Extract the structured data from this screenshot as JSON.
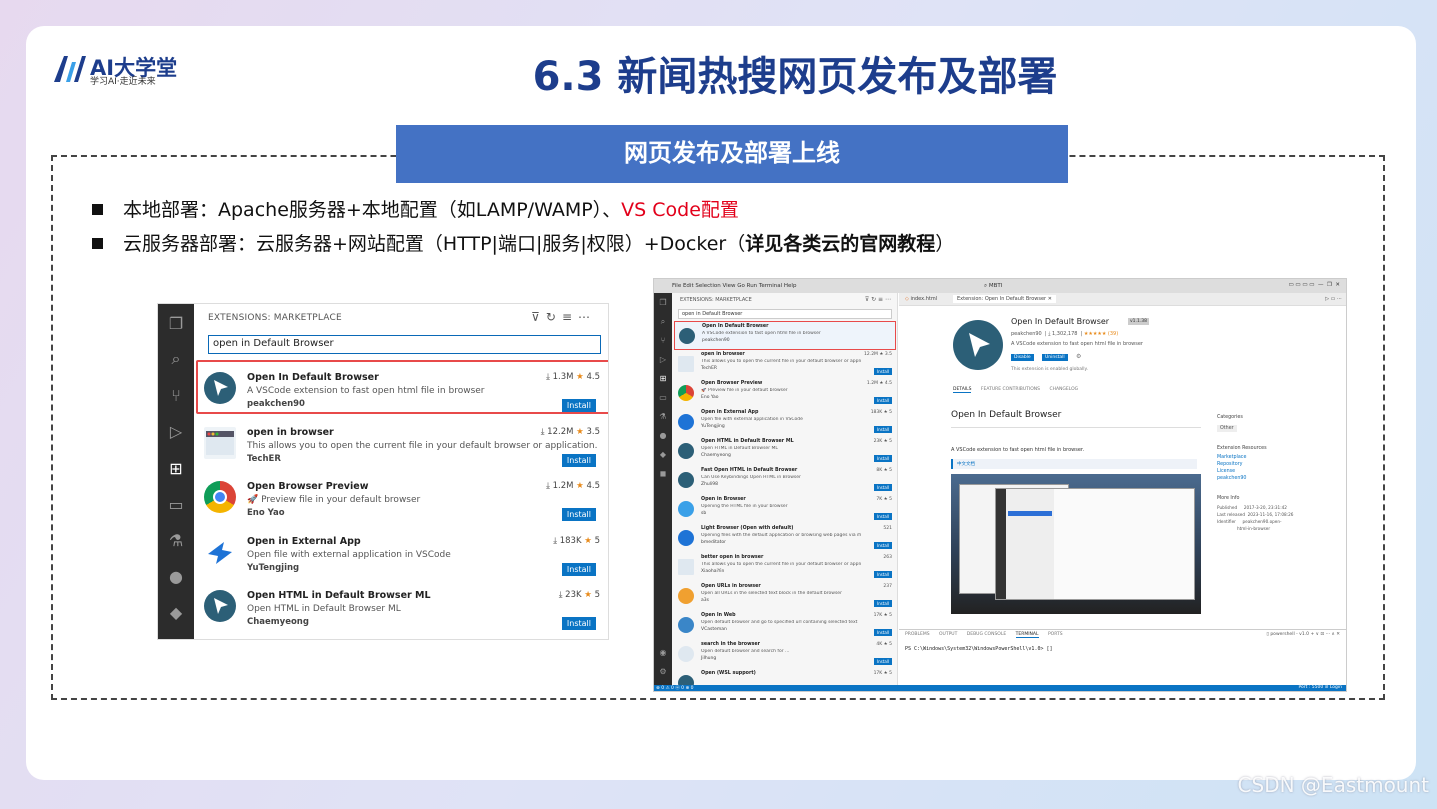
{
  "colors": {
    "accent": "#4472c4",
    "title": "#1d3d8c",
    "red": "#e2001a",
    "install_button": "#0a74c4"
  },
  "logo": {
    "name": "AI大学堂",
    "slogan": "学习AI·走近未来"
  },
  "title": "6.3 新闻热搜网页发布及部署",
  "banner": "网页发布及部署上线",
  "bullets": [
    {
      "prefix": "本地部署：Apache服务器+本地配置（如LAMP/WAMP）、",
      "highlight": "VS Code配置",
      "suffix": ""
    },
    {
      "prefix": "云服务器部署：云服务器+网站配置（HTTP|端口|服务|权限）+Docker（",
      "bold": "详见各类云的官网教程",
      "suffix": "）"
    }
  ],
  "left_screenshot": {
    "header": "EXTENSIONS: MARKETPLACE",
    "search_value": "open in Default Browser",
    "items": [
      {
        "name": "Open In Default Browser",
        "desc": "A VSCode extension to fast open html file in browser",
        "author": "peakchen90",
        "downloads": "1.3M",
        "rating": "4.5",
        "button": "Install",
        "icon": "cursor-icon"
      },
      {
        "name": "open in browser",
        "desc": "This allows you to open the current file in your default browser or application.",
        "author": "TechER",
        "downloads": "12.2M",
        "rating": "3.5",
        "button": "Install",
        "icon": "browser-window-icon"
      },
      {
        "name": "Open Browser Preview",
        "desc": "🚀 Preview file in your default browser",
        "author": "Eno Yao",
        "downloads": "1.2M",
        "rating": "4.5",
        "button": "Install",
        "icon": "chrome-icon"
      },
      {
        "name": "Open in External App",
        "desc": "Open file with external application in VSCode",
        "author": "YuTengjing",
        "downloads": "183K",
        "rating": "5",
        "button": "Install",
        "icon": "arrow-icon"
      },
      {
        "name": "Open HTML in Default Browser ML",
        "desc": "Open HTML in Default Browser ML",
        "author": "Chaemyeong",
        "downloads": "23K",
        "rating": "5",
        "button": "Install",
        "icon": "cursor-icon"
      }
    ]
  },
  "right_screenshot": {
    "menu": "File  Edit  Selection  View  Go  Run  Terminal  Help",
    "search": "MBTI",
    "sidebar_header": "EXTENSIONS: MARKETPLACE",
    "search_value": "open in Default Browser",
    "items": [
      {
        "name": "Open In Default Browser",
        "desc": "A VSCode extension to fast open html file in browser",
        "author": "peakchen90",
        "stats": "",
        "button": ""
      },
      {
        "name": "open in browser",
        "desc": "This allows you to open the current file in your default browser or application.",
        "author": "TechER",
        "stats": "12.2M ★ 3.5",
        "button": "Install"
      },
      {
        "name": "Open Browser Preview",
        "desc": "🚀 Preview file in your default browser",
        "author": "Eno Yao",
        "stats": "1.2M ★ 4.5",
        "button": "Install"
      },
      {
        "name": "Open in External App",
        "desc": "Open file with external application in VSCode",
        "author": "YuTengjing",
        "stats": "183K ★ 5",
        "button": "Install"
      },
      {
        "name": "Open HTML in Default Browser ML",
        "desc": "Open HTML in Default Browser ML",
        "author": "Chaemyeong",
        "stats": "23K ★ 5",
        "button": "Install"
      },
      {
        "name": "Fast Open HTML in Default Browser",
        "desc": "Can Use Keybindings Open HTML in Browser",
        "author": "Zhuli98",
        "stats": "8K ★ 5",
        "button": "Install"
      },
      {
        "name": "Open in Browser",
        "desc": "Opening the HTML file in your browser",
        "author": "sb",
        "stats": "7K ★ 5",
        "button": "Install"
      },
      {
        "name": "Light Browser (Open with default)",
        "desc": "Opening files with the default application or browsing web pages via iframe in l...",
        "author": "bmeditator",
        "stats": "521",
        "button": "Install"
      },
      {
        "name": "better open in browser",
        "desc": "This allows you to open the current file in your default browser or application.",
        "author": "XiaohaiYin",
        "stats": "263",
        "button": "Install"
      },
      {
        "name": "Open URLs in browser",
        "desc": "Open all URLs in the selected text block in the default browser",
        "author": "a3s",
        "stats": "237",
        "button": "Install"
      },
      {
        "name": "Open In Web",
        "desc": "Open default browser and go to specified url containing selected text",
        "author": "VCasteman",
        "stats": "17K ★ 5",
        "button": "Install"
      },
      {
        "name": "search in the browser",
        "desc": "Open default browser and search for ...",
        "author": "Jilhung",
        "stats": "4K ★ 5",
        "button": "Install"
      },
      {
        "name": "Open (WSL support)",
        "desc": "",
        "author": "",
        "stats": "17K ★ 5",
        "button": ""
      }
    ],
    "tabs": [
      "index.html",
      "Extension: Open In Default Browser"
    ],
    "detail": {
      "name": "Open In Default Browser",
      "version": "v1.1.38",
      "author": "peakchen90",
      "installs": "1,302,178",
      "rating": "★★★★★ (39)",
      "desc": "A VSCode extension to fast open html file in browser",
      "btn_disable": "Disable",
      "btn_uninstall": "Uninstall",
      "enabled": "This extension is enabled globally.",
      "subtabs": [
        "DETAILS",
        "FEATURE CONTRIBUTIONS",
        "CHANGELOG"
      ],
      "readme_title": "Open In Default Browser",
      "readme_text": "A VSCode extension to fast open html file in browser.",
      "readme_link": "中文文档",
      "categories_h": "Categories",
      "category": "Other",
      "resources_h": "Extension Resources",
      "resources": [
        "Marketplace",
        "Repository",
        "License",
        "peakchen90"
      ],
      "more_h": "More Info",
      "more": [
        "Published     2017-3-20, 23:31:42",
        "Last released  2023-11-16, 17:08:26",
        "Identifier     peakchen90.open-",
        "               html-in-browser"
      ]
    },
    "panel_tabs": [
      "PROBLEMS",
      "OUTPUT",
      "DEBUG CONSOLE",
      "TERMINAL",
      "PORTS"
    ],
    "panel_shell": "powershell - v1.0",
    "prompt": "PS C:\\Windows\\System32\\WindowsPowerShell\\v1.0> []",
    "status_left": "⊗ 0 ⚠ 0   ⓦ 0   ⊕ 0",
    "status_right": "Port : 5500   ⊘ Login"
  },
  "watermark": "CSDN @Eastmount"
}
